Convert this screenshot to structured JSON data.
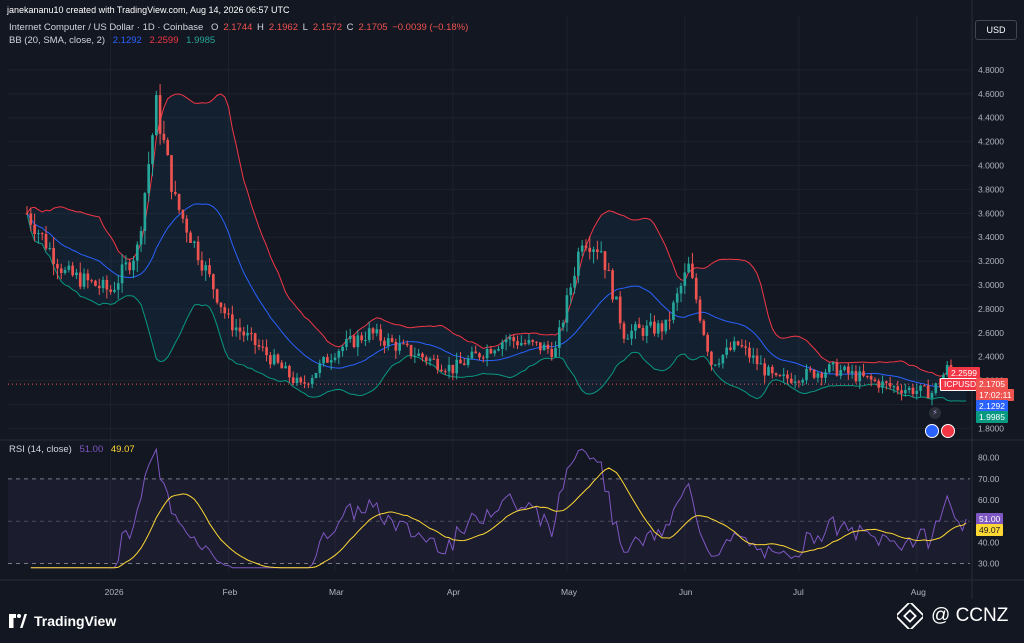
{
  "header": {
    "created_by": "janekananu10 created with TradingView.com, Aug 14, 2026 06:57 UTC"
  },
  "legend": {
    "symbol": "Internet Computer / US Dollar · 1D · Coinbase",
    "o_label": "O",
    "o_value": "2.1744",
    "h_label": "H",
    "h_value": "2.1962",
    "l_label": "L",
    "l_value": "2.1572",
    "c_label": "C",
    "c_value": "2.1705",
    "change": "−0.0039 (−0.18%)",
    "bb_label": "BB (20, SMA, close, 2)",
    "bb_basis": "2.1292",
    "bb_upper": "2.2599",
    "bb_lower": "1.9985",
    "rsi_label": "RSI (14, close)",
    "rsi_value": "51.00",
    "rsi_ma": "49.07"
  },
  "currency_button": "USD",
  "price_tags": {
    "upper": "2.2599",
    "symbol": "ICPUSD",
    "last": "2.1705",
    "countdown": "17:02:11",
    "basis": "2.1292",
    "lower": "1.9985",
    "rsi": "51.00",
    "rsi_ma": "49.07"
  },
  "colors": {
    "background": "#131722",
    "grid": "#1e222d",
    "up": "#26a69a",
    "down": "#ef5350",
    "bb_upper": "#f23645",
    "bb_basis": "#2962ff",
    "bb_lower": "#089981",
    "bb_fill": "#2196f3",
    "rsi_line": "#7e57c2",
    "rsi_ma": "#fdd835",
    "rsi_band": "#7e57c2"
  },
  "footer": {
    "brand": "TradingView",
    "watermark": "@ CCNZ"
  },
  "chart_data": [
    {
      "type": "candlestick",
      "title": "Internet Computer / US Dollar · 1D · Coinbase",
      "x_tick_labels": [
        "2026",
        "Feb",
        "Mar",
        "Apr",
        "May",
        "Jun",
        "Jul",
        "Aug"
      ],
      "y_tick_labels": [
        "1.8000",
        "2.0000",
        "2.2000",
        "2.4000",
        "2.6000",
        "2.8000",
        "3.0000",
        "3.2000",
        "3.4000",
        "3.6000",
        "3.8000",
        "4.0000",
        "4.2000",
        "4.4000",
        "4.6000",
        "4.8000"
      ],
      "ylim": [
        1.72,
        5.0
      ],
      "gridlines": true,
      "overlay": "Bollinger Bands (20, SMA, close, 2)",
      "last_values": {
        "close": 2.1705,
        "bb_upper": 2.2599,
        "bb_basis": 2.1292,
        "bb_lower": 1.9985
      },
      "approx_close_path": [
        {
          "date": "2025-12-10",
          "close": 3.6
        },
        {
          "date": "2025-12-20",
          "close": 3.1
        },
        {
          "date": "2026-01-01",
          "close": 2.95
        },
        {
          "date": "2026-01-08",
          "close": 3.3
        },
        {
          "date": "2026-01-13",
          "close": 4.5
        },
        {
          "date": "2026-01-18",
          "close": 3.7
        },
        {
          "date": "2026-01-25",
          "close": 3.2
        },
        {
          "date": "2026-02-01",
          "close": 2.7
        },
        {
          "date": "2026-02-10",
          "close": 2.45
        },
        {
          "date": "2026-02-20",
          "close": 2.15
        },
        {
          "date": "2026-03-01",
          "close": 2.45
        },
        {
          "date": "2026-03-10",
          "close": 2.6
        },
        {
          "date": "2026-03-20",
          "close": 2.45
        },
        {
          "date": "2026-04-01",
          "close": 2.3
        },
        {
          "date": "2026-04-15",
          "close": 2.55
        },
        {
          "date": "2026-04-28",
          "close": 2.45
        },
        {
          "date": "2026-05-05",
          "close": 3.4
        },
        {
          "date": "2026-05-10",
          "close": 3.3
        },
        {
          "date": "2026-05-16",
          "close": 2.6
        },
        {
          "date": "2026-05-27",
          "close": 2.65
        },
        {
          "date": "2026-06-02",
          "close": 3.15
        },
        {
          "date": "2026-06-08",
          "close": 2.35
        },
        {
          "date": "2026-06-15",
          "close": 2.5
        },
        {
          "date": "2026-06-25",
          "close": 2.2
        },
        {
          "date": "2026-07-10",
          "close": 2.3
        },
        {
          "date": "2026-07-25",
          "close": 2.15
        },
        {
          "date": "2026-08-05",
          "close": 2.1
        },
        {
          "date": "2026-08-09",
          "close": 2.3
        },
        {
          "date": "2026-08-14",
          "close": 2.1705
        }
      ]
    },
    {
      "type": "line",
      "title": "RSI (14, close)",
      "y_tick_labels": [
        "30.00",
        "40.00",
        "50.00",
        "60.00",
        "70.00",
        "80.00"
      ],
      "ylim": [
        26,
        86
      ],
      "bands": [
        30,
        70
      ],
      "series": [
        {
          "name": "RSI",
          "last": 51.0
        },
        {
          "name": "RSI MA",
          "last": 49.07
        }
      ]
    }
  ]
}
